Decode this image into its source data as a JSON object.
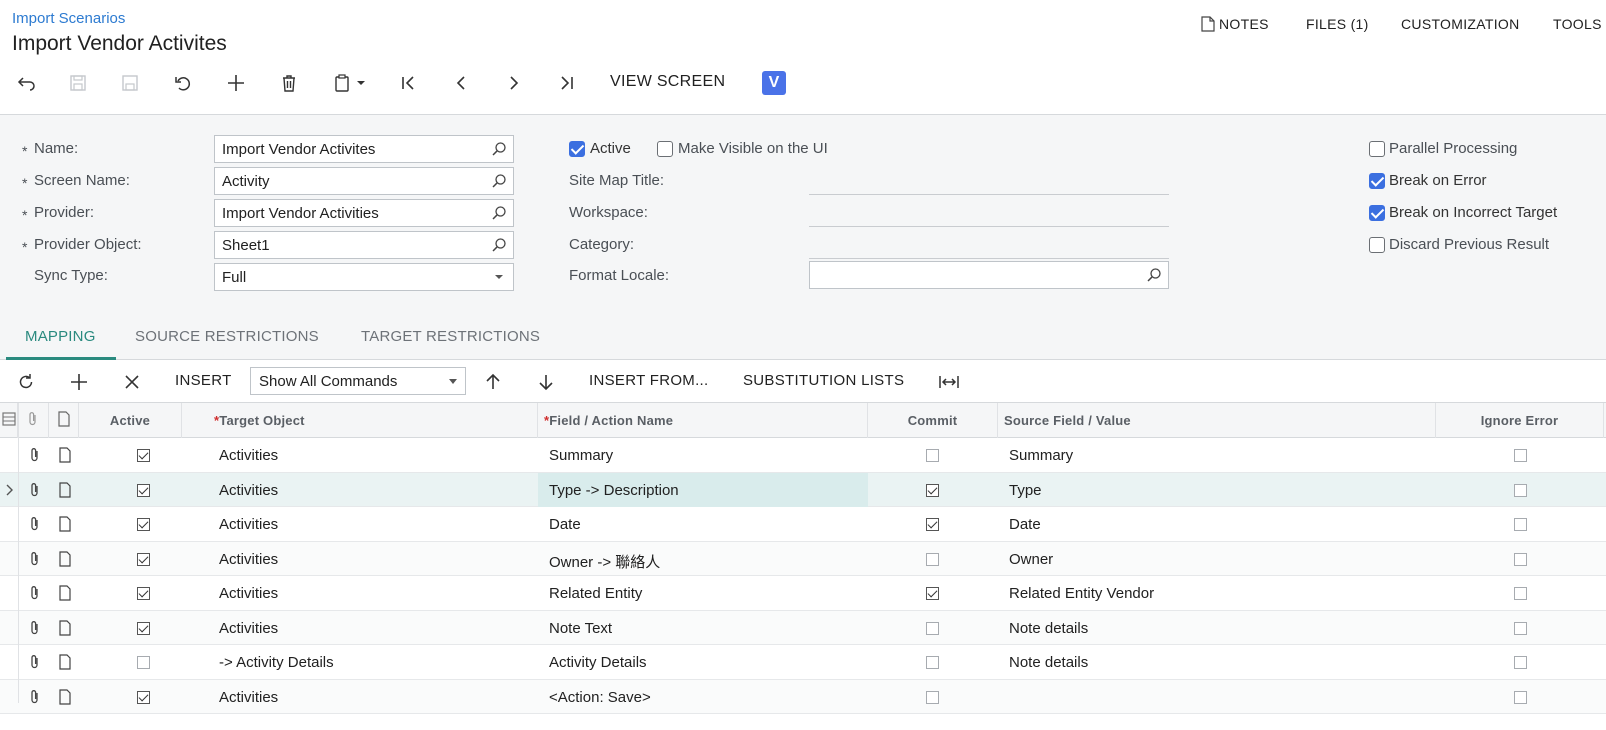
{
  "header": {
    "breadcrumb": "Import Scenarios",
    "title": "Import Vendor Activites",
    "menu": {
      "notes": "NOTES",
      "files": "FILES (1)",
      "customization": "CUSTOMIZATION",
      "tools": "TOOLS"
    },
    "view_screen": "VIEW SCREEN",
    "badge": "V"
  },
  "form": {
    "name_label": "Name:",
    "name_value": "Import Vendor Activites",
    "screen_label": "Screen Name:",
    "screen_value": "Activity",
    "provider_label": "Provider:",
    "provider_value": "Import Vendor Activities",
    "provider_object_label": "Provider Object:",
    "provider_object_value": "Sheet1",
    "sync_label": "Sync Type:",
    "sync_value": "Full",
    "active_label": "Active",
    "visible_label": "Make Visible on the UI",
    "sitemap_label": "Site Map Title:",
    "workspace_label": "Workspace:",
    "category_label": "Category:",
    "locale_label": "Format Locale:",
    "parallel_label": "Parallel Processing",
    "break_error_label": "Break on Error",
    "break_target_label": "Break on Incorrect Target",
    "discard_label": "Discard Previous Result"
  },
  "tabs": {
    "mapping": "MAPPING",
    "source": "SOURCE RESTRICTIONS",
    "target": "TARGET RESTRICTIONS"
  },
  "grid_toolbar": {
    "insert": "INSERT",
    "commands": "Show All Commands",
    "insert_from": "INSERT FROM...",
    "subst": "SUBSTITUTION LISTS"
  },
  "grid": {
    "headers": {
      "active": "Active",
      "target": "Target Object",
      "field": "Field / Action Name",
      "commit": "Commit",
      "source": "Source Field / Value",
      "ignore": "Ignore Error"
    },
    "rows": [
      {
        "active": true,
        "target": "Activities",
        "field": "Summary",
        "commit": false,
        "source": "Summary",
        "ignore": false
      },
      {
        "active": true,
        "target": "Activities",
        "field": "Type -> Description",
        "commit": true,
        "source": "Type",
        "ignore": false
      },
      {
        "active": true,
        "target": "Activities",
        "field": "Date",
        "commit": true,
        "source": "Date",
        "ignore": false
      },
      {
        "active": true,
        "target": "Activities",
        "field": "Owner -> 聯絡人",
        "commit": false,
        "source": "Owner",
        "ignore": false
      },
      {
        "active": true,
        "target": "Activities",
        "field": "Related Entity",
        "commit": true,
        "source": "Related Entity Vendor",
        "ignore": false
      },
      {
        "active": true,
        "target": "Activities",
        "field": "Note Text",
        "commit": false,
        "source": "Note details",
        "ignore": false
      },
      {
        "active": false,
        "target": "-> Activity Details",
        "field": "Activity Details",
        "commit": false,
        "source": "Note details",
        "ignore": false
      },
      {
        "active": true,
        "target": "Activities",
        "field": "<Action: Save>",
        "commit": false,
        "source": "",
        "ignore": false
      }
    ]
  }
}
